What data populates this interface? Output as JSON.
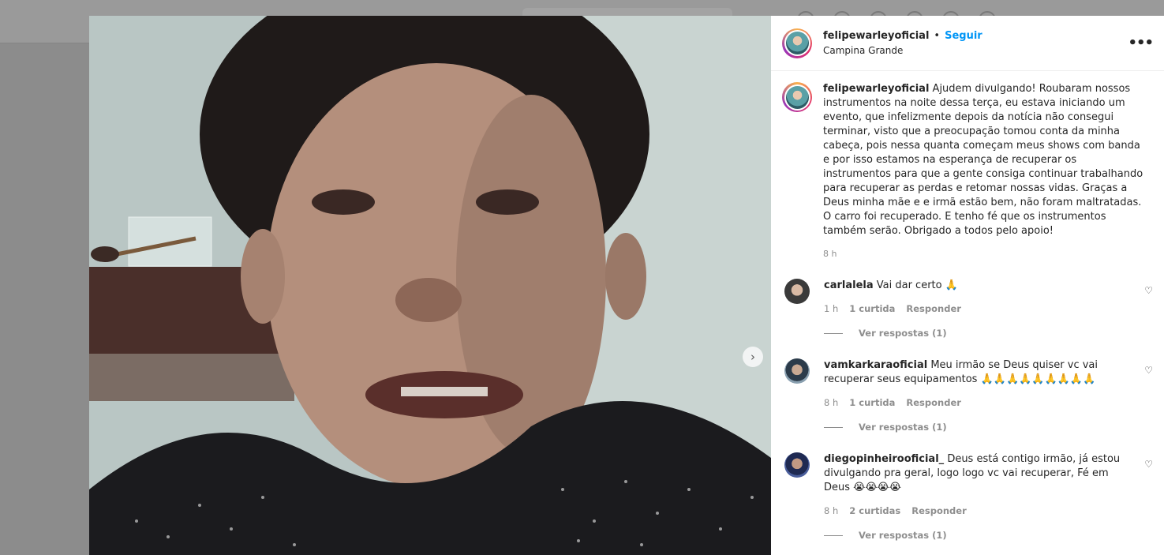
{
  "post": {
    "username": "felipewarleyoficial",
    "follow_label": "Seguir",
    "separator": "•",
    "location": "Campina Grande",
    "more_label": "•••",
    "caption_text": "Ajudem divulgando! Roubaram nossos instrumentos na noite dessa terça, eu estava iniciando um evento, que infelizmente depois da notícia não consegui terminar, visto que a preocupação tomou conta da minha cabeça, pois nessa quanta começam meus shows com banda e por isso estamos na esperança de recuperar os instrumentos para que a gente consiga continuar trabalhando para recuperar as perdas e retomar nossas vidas. Graças a Deus minha mãe e e irmã estão bem, não foram maltratadas. O carro foi recuperado. E tenho fé que os instrumentos também serão. Obrigado a todos pelo apoio!",
    "caption_time": "8 h",
    "next_icon": "›"
  },
  "comments": [
    {
      "username": "carlalela",
      "text": "Vai dar certo 🙏",
      "time": "1 h",
      "likes": "1 curtida",
      "reply_label": "Responder",
      "view_replies": "Ver respostas (1)"
    },
    {
      "username": "vamkarkaraoficial",
      "text": "Meu irmão se Deus quiser vc vai recuperar seus equipamentos 🙏🙏🙏🙏🙏🙏🙏🙏🙏",
      "time": "8 h",
      "likes": "1 curtida",
      "reply_label": "Responder",
      "view_replies": "Ver respostas (1)"
    },
    {
      "username": "diegopinheirooficial_",
      "text": "Deus está contigo irmão, já estou divulgando pra geral, logo logo vc vai recuperar, Fé em Deus 😭😭😭😭",
      "time": "8 h",
      "likes": "2 curtidas",
      "reply_label": "Responder",
      "view_replies": "Ver respostas (1)"
    }
  ],
  "icons": {
    "heart": "♡"
  },
  "colors": {
    "accent": "#0095f6",
    "text": "#262626",
    "muted": "#8e8e8e"
  }
}
